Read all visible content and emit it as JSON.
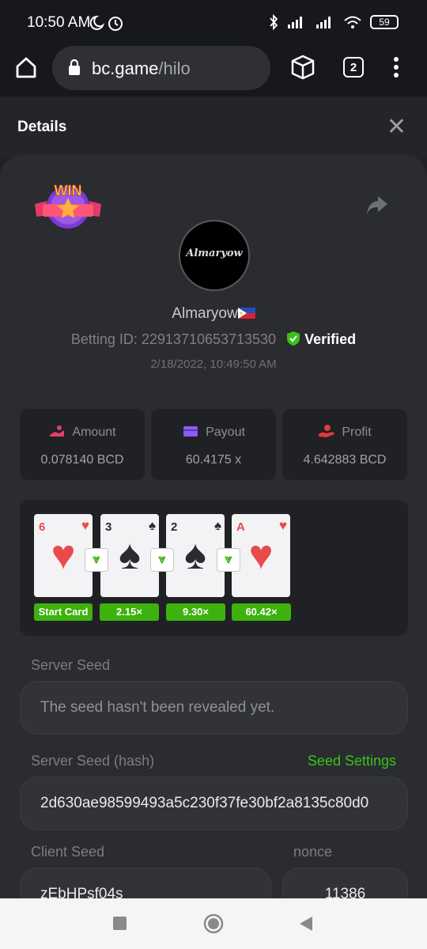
{
  "status_bar": {
    "time": "10:50 AM",
    "battery": "59"
  },
  "browser": {
    "url_host": "bc.game",
    "url_path": "/hilo",
    "tab_count": "2"
  },
  "details": {
    "title": "Details",
    "username": "Almaryow",
    "avatar_text": "Almaryow",
    "badge_text": "WIN",
    "betting_id": "Betting ID: 22913710653713530",
    "verified_label": "Verified",
    "date": "2/18/2022, 10:49:50 AM"
  },
  "stats": [
    {
      "label": "Amount",
      "value": "0.078140 BCD",
      "icon": "amount-icon"
    },
    {
      "label": "Payout",
      "value": "60.4175 x",
      "icon": "wallet-icon"
    },
    {
      "label": "Profit",
      "value": "4.642883 BCD",
      "icon": "profit-icon"
    }
  ],
  "cards": [
    {
      "rank": "6",
      "suit": "♥",
      "color": "#e84b4b",
      "multiplier": "Start Card"
    },
    {
      "rank": "3",
      "suit": "♠",
      "color": "#2a2c30",
      "multiplier": "2.15×"
    },
    {
      "rank": "2",
      "suit": "♠",
      "color": "#2a2c30",
      "multiplier": "9.30×"
    },
    {
      "rank": "A",
      "suit": "♥",
      "color": "#e84b4b",
      "multiplier": "60.42×"
    }
  ],
  "seeds": {
    "server_seed_label": "Server Seed",
    "server_seed_value": "The seed hasn't been revealed yet.",
    "server_seed_hash_label": "Server Seed (hash)",
    "seed_settings_label": "Seed Settings",
    "server_seed_hash_value": "2d630ae98599493a5c230f37fe30bf2a8135c80d0",
    "client_seed_label": "Client Seed",
    "client_seed_value": "zEbHPsf04s",
    "nonce_label": "nonce",
    "nonce_value": "11386"
  },
  "colors": {
    "accent_green": "#3db20e",
    "seed_settings": "#3bc117",
    "panel": "#2a2c30"
  }
}
